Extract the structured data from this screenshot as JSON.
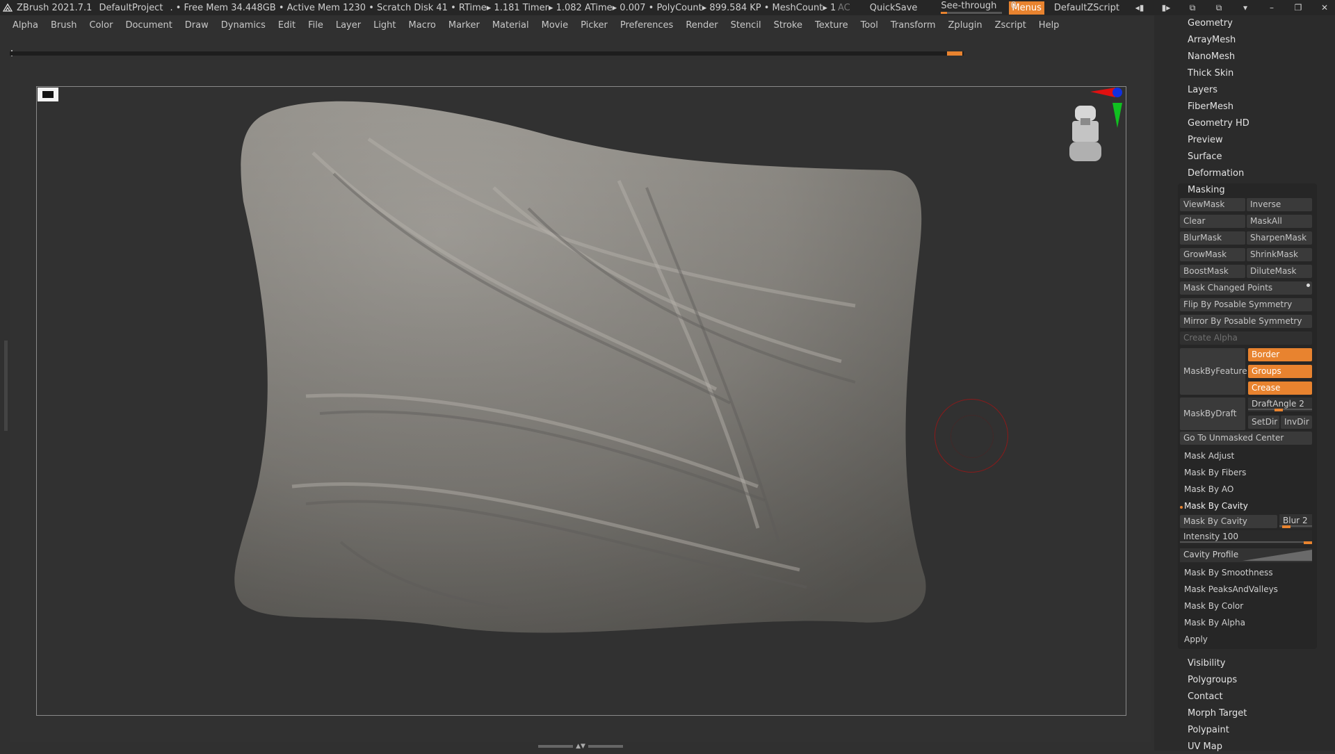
{
  "titlebar": {
    "app": "ZBrush 2021.7.1",
    "project": "DefaultProject",
    "stats": ". • Free Mem 34.448GB • Active Mem 1230 • Scratch Disk 41 •  RTime▸ 1.181 Timer▸ 1.082 ATime▸ 0.007 • PolyCount▸ 899.584 KP  • MeshCount▸ 1",
    "ac": "AC",
    "quicksave": "QuickSave",
    "seethrough_label": "See-through",
    "seethrough_value": "0",
    "seethrough_fraction": 0.1,
    "menus": "Menus",
    "zscript": "DefaultZScript",
    "accent": "#e8832f"
  },
  "menubar": [
    "Alpha",
    "Brush",
    "Color",
    "Document",
    "Draw",
    "Dynamics",
    "Edit",
    "File",
    "Layer",
    "Light",
    "Macro",
    "Marker",
    "Material",
    "Movie",
    "Picker",
    "Preferences",
    "Render",
    "Stencil",
    "Stroke",
    "Texture",
    "Tool",
    "Transform",
    "Zplugin",
    "Zscript",
    "Help"
  ],
  "tray_top": [
    "Geometry",
    "ArrayMesh",
    "NanoMesh",
    "Thick Skin",
    "Layers",
    "FiberMesh",
    "Geometry HD",
    "Preview",
    "Surface",
    "Deformation"
  ],
  "masking": {
    "header": "Masking",
    "viewmask": "ViewMask",
    "inverse": "Inverse",
    "clear": "Clear",
    "maskall": "MaskAll",
    "blurmask": "BlurMask",
    "sharpenmask": "SharpenMask",
    "growmask": "GrowMask",
    "shrinkmask": "ShrinkMask",
    "boostmask": "BoostMask",
    "dilutemask": "DiluteMask",
    "mask_changed_points": "Mask Changed Points",
    "flip_symmetry": "Flip By Posable Symmetry",
    "mirror_symmetry": "Mirror By Posable Symmetry",
    "create_alpha": "Create Alpha",
    "maskbyfeature": "MaskByFeature",
    "border": "Border",
    "groups": "Groups",
    "crease": "Crease",
    "maskbydraft": "MaskByDraft",
    "draftangle_label": "DraftAngle",
    "draftangle_value": "2",
    "setdir": "SetDir",
    "invdir": "InvDir",
    "go_unmasked": "Go To Unmasked Center",
    "mask_adjust": "Mask Adjust",
    "mask_fibers": "Mask By Fibers",
    "mask_ao": "Mask By AO",
    "mask_cavity_header": "Mask By Cavity",
    "mask_cavity_btn": "Mask By Cavity",
    "blur_label": "Blur",
    "blur_value": "2",
    "intensity_label": "Intensity",
    "intensity_value": "100",
    "cavity_profile": "Cavity Profile",
    "mask_smoothness": "Mask By Smoothness",
    "mask_peaks": "Mask PeaksAndValleys",
    "mask_color": "Mask By Color",
    "mask_alpha": "Mask By Alpha",
    "apply": "Apply"
  },
  "tray_bottom": [
    "Visibility",
    "Polygroups",
    "Contact",
    "Morph Target",
    "Polypaint",
    "UV Map"
  ]
}
